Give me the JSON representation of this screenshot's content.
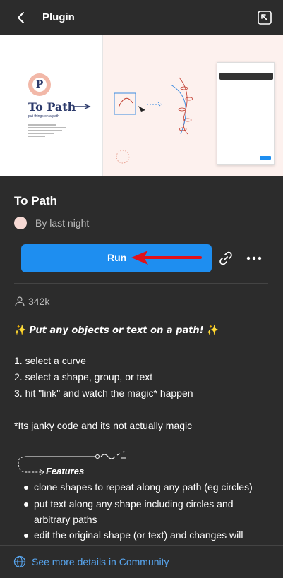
{
  "header": {
    "title": "Plugin",
    "back_icon": "chevron-left-icon",
    "popout_icon": "open-in-window-icon"
  },
  "hero": {
    "logo_letter": "P",
    "title": "To Path",
    "subtitle": "put things on a path"
  },
  "plugin": {
    "name": "To Path",
    "author": "By last night"
  },
  "actions": {
    "run_label": "Run",
    "link_icon": "link-icon",
    "more_icon": "more-horizontal-icon"
  },
  "stats": {
    "users": "342k"
  },
  "description": {
    "tagline": "Put any objects or text on a path!",
    "steps": [
      "1. select a curve",
      "2. select a shape, group, or text",
      "3. hit \"link\" and watch the magic* happen"
    ],
    "footnote": "*Its janky code and its not actually magic",
    "features_label": "Features",
    "features": [
      "clone shapes to repeat along any path (eg circles)",
      "put text along any shape including circles and",
      "arbitrary paths",
      "edit the original shape (or text) and changes will"
    ]
  },
  "footer": {
    "link_label": "See more details in Community"
  },
  "colors": {
    "background": "#2c2c2c",
    "accent": "#1e8ef0",
    "link": "#58a6f0",
    "annotation_arrow": "#e0121a"
  }
}
